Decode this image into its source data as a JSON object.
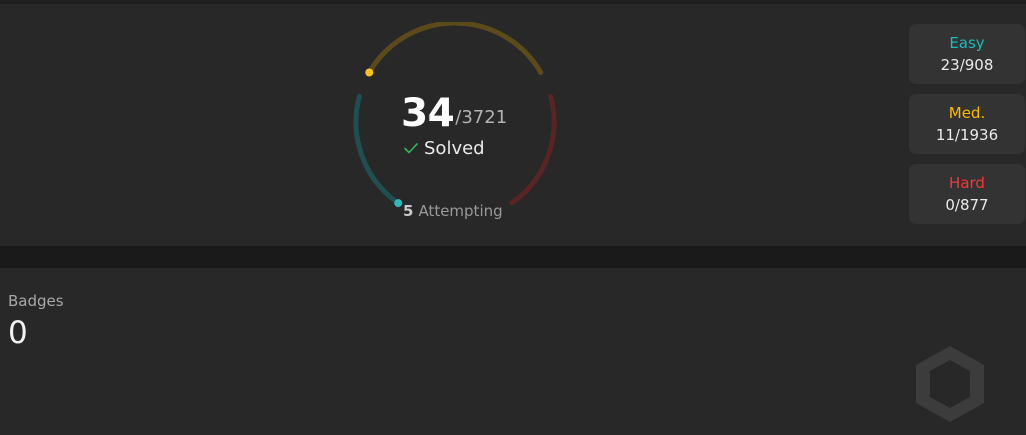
{
  "progress": {
    "solved": "34",
    "total": "/3721",
    "solved_label": "Solved",
    "attempting_count": "5",
    "attempting_label": "Attempting"
  },
  "difficulty": [
    {
      "label": "Easy",
      "value": "23/908",
      "color": "#1cbaba"
    },
    {
      "label": "Med.",
      "value": "11/1936",
      "color": "#ffb700"
    },
    {
      "label": "Hard",
      "value": "0/877",
      "color": "#f63737"
    }
  ],
  "ring_colors": {
    "easy_track": "#1f4f52",
    "medium_track": "#5c4a1a",
    "hard_track": "#5a2424",
    "easy_dot": "#2cbbbd",
    "medium_dot": "#ffc01e"
  },
  "badges": {
    "label": "Badges",
    "count": "0"
  },
  "icons": {
    "check": "check-icon",
    "watermark": "hexagon-badge-icon"
  }
}
